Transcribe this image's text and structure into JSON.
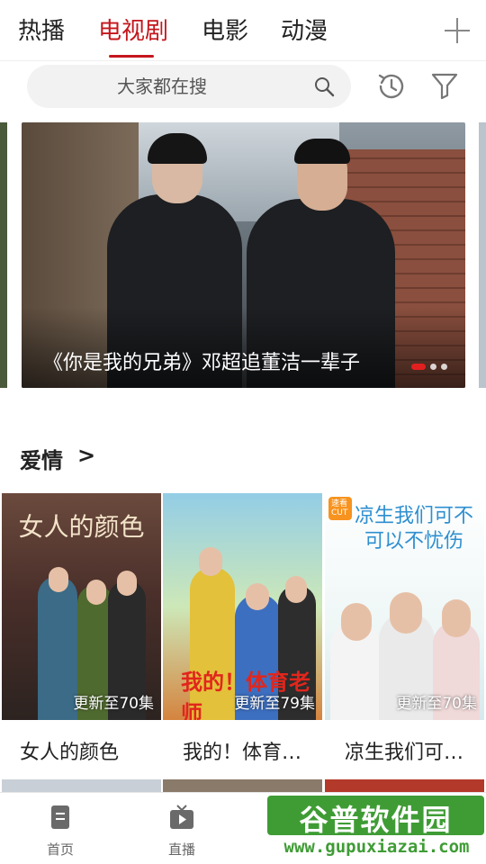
{
  "tabs": [
    {
      "label": "热播",
      "active": false
    },
    {
      "label": "电视剧",
      "active": true
    },
    {
      "label": "电影",
      "active": false
    },
    {
      "label": "动漫",
      "active": false
    }
  ],
  "search": {
    "placeholder": "大家都在搜"
  },
  "icons": {
    "add": "plus-icon",
    "search": "search-icon",
    "history": "history-clock-icon",
    "filter": "filter-funnel-icon",
    "home": "home-page-icon",
    "live": "tv-live-icon"
  },
  "banner": {
    "caption": "《你是我的兄弟》邓超追董洁一辈子",
    "dots": 3,
    "active_dot": 0
  },
  "section": {
    "title": "爱情",
    "arrow": ">"
  },
  "posters": [
    {
      "title": "女人的颜色",
      "episode": "更新至70集",
      "art": "女人的颜色"
    },
    {
      "title": "我的！体育…",
      "episode": "更新至79集",
      "art": "我的！体育老师",
      "art_label": "我的！体育老师"
    },
    {
      "title": "凉生我们可…",
      "episode": "更新至70集",
      "art": "凉生我们可不可以不忧伤",
      "badge": "速看 CUT"
    }
  ],
  "bottom_nav": [
    {
      "label": "首页"
    },
    {
      "label": "直播"
    }
  ],
  "watermark": {
    "title": "谷普软件园",
    "url": "www.gupuxiazai.com"
  },
  "colors": {
    "accent": "#c4161c",
    "watermark_green": "#3f9c35"
  }
}
